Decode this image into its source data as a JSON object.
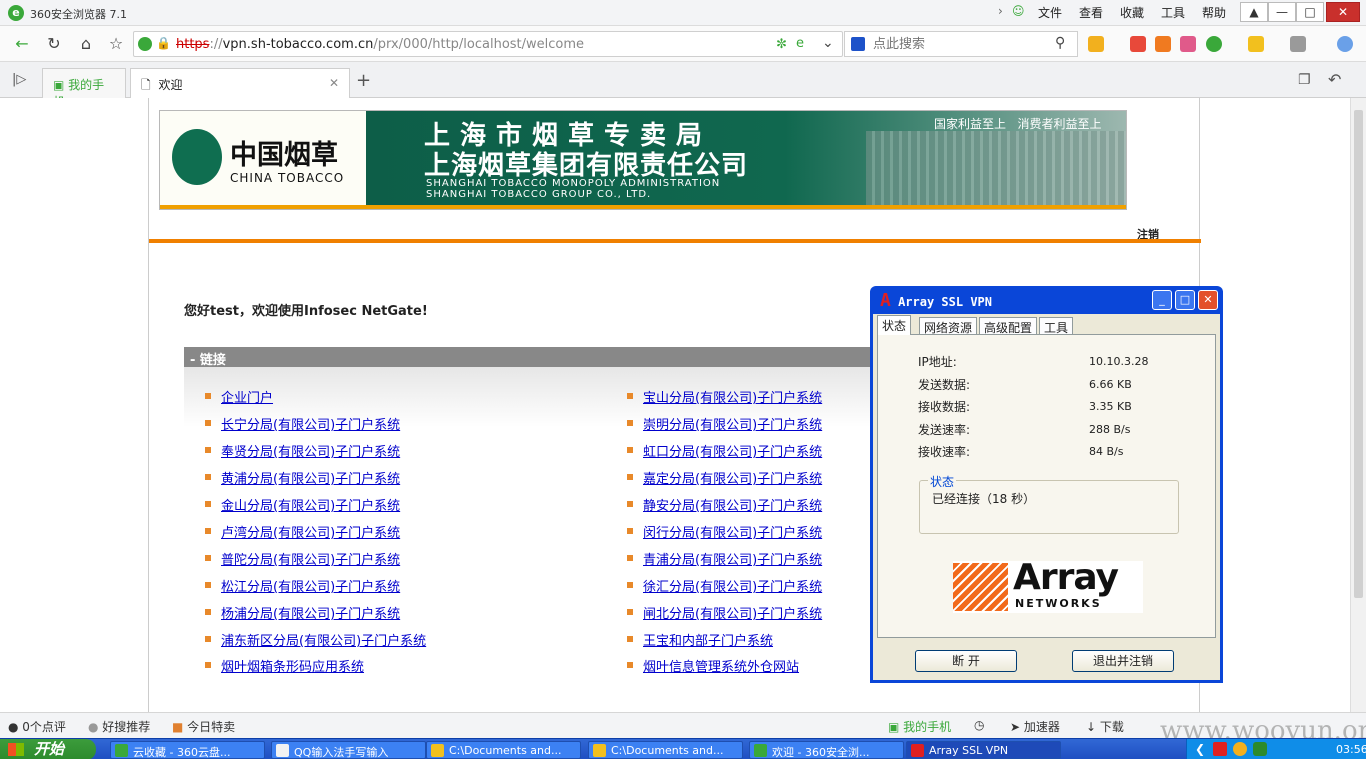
{
  "browser": {
    "title": "360安全浏览器 7.1",
    "menu": [
      "文件",
      "查看",
      "收藏",
      "工具",
      "帮助"
    ],
    "url_scheme": "https",
    "url_host": "vpn.sh-tobacco.com.cn",
    "url_path": "/prx/000/http/localhost/welcome",
    "search_placeholder": "点此搜索",
    "tabs": [
      {
        "label": "我的手机"
      },
      {
        "label": "欢迎"
      }
    ]
  },
  "page": {
    "banner": {
      "brand_cn": "中国烟草",
      "brand_en": "CHINA TOBACCO",
      "line1": "上海市烟草专卖局",
      "line2": "上海烟草集团有限责任公司",
      "line3": "SHANGHAI TOBACCO MONOPOLY ADMINISTRATION",
      "line4": "SHANGHAI TOBACCO GROUP CO., LTD.",
      "slogan": "国家利益至上   消费者利益至上"
    },
    "logout": "注销",
    "welcome": "您好test，欢迎使用Infosec NetGate!",
    "links_header": "- 链接",
    "links_left": [
      "企业门户",
      "长宁分局(有限公司)子门户系统",
      "奉贤分局(有限公司)子门户系统",
      "黄浦分局(有限公司)子门户系统",
      "金山分局(有限公司)子门户系统",
      "卢湾分局(有限公司)子门户系统",
      "普陀分局(有限公司)子门户系统",
      "松江分局(有限公司)子门户系统",
      "杨浦分局(有限公司)子门户系统",
      "浦东新区分局(有限公司)子门户系统",
      "烟叶烟箱条形码应用系统"
    ],
    "links_right": [
      "宝山分局(有限公司)子门户系统",
      "崇明分局(有限公司)子门户系统",
      "虹口分局(有限公司)子门户系统",
      "嘉定分局(有限公司)子门户系统",
      "静安分局(有限公司)子门户系统",
      "闵行分局(有限公司)子门户系统",
      "青浦分局(有限公司)子门户系统",
      "徐汇分局(有限公司)子门户系统",
      "闸北分局(有限公司)子门户系统",
      "王宝和内部子门户系统",
      "烟叶信息管理系统外仓网站"
    ]
  },
  "vpn": {
    "title": "Array SSL VPN",
    "tabs": [
      "状态",
      "网络资源",
      "高级配置",
      "工具"
    ],
    "fields": [
      {
        "label": "IP地址:",
        "value": "10.10.3.28"
      },
      {
        "label": "发送数据:",
        "value": "6.66 KB"
      },
      {
        "label": "接收数据:",
        "value": "3.35 KB"
      },
      {
        "label": "发送速率:",
        "value": "288 B/s"
      },
      {
        "label": "接收速率:",
        "value": "84 B/s"
      }
    ],
    "group_label": "状态",
    "status_text": "已经连接（18 秒）",
    "logo_word": "Array",
    "logo_sub": "NETWORKS",
    "btn_disconnect": "断 开",
    "btn_exit": "退出并注销"
  },
  "statusbar": {
    "left": [
      "0个点评",
      "好搜推荐",
      "今日特卖"
    ],
    "right": [
      "我的手机",
      "加速器",
      "下载"
    ]
  },
  "taskbar": {
    "start": "开始",
    "tasks": [
      "云收藏 - 360云盘...",
      "QQ输入法手写输入",
      "C:\\Documents and...",
      "C:\\Documents and...",
      "欢迎 - 360安全浏...",
      "Array SSL VPN"
    ],
    "clock": "03:56"
  },
  "watermark": "www.wooyun.org"
}
